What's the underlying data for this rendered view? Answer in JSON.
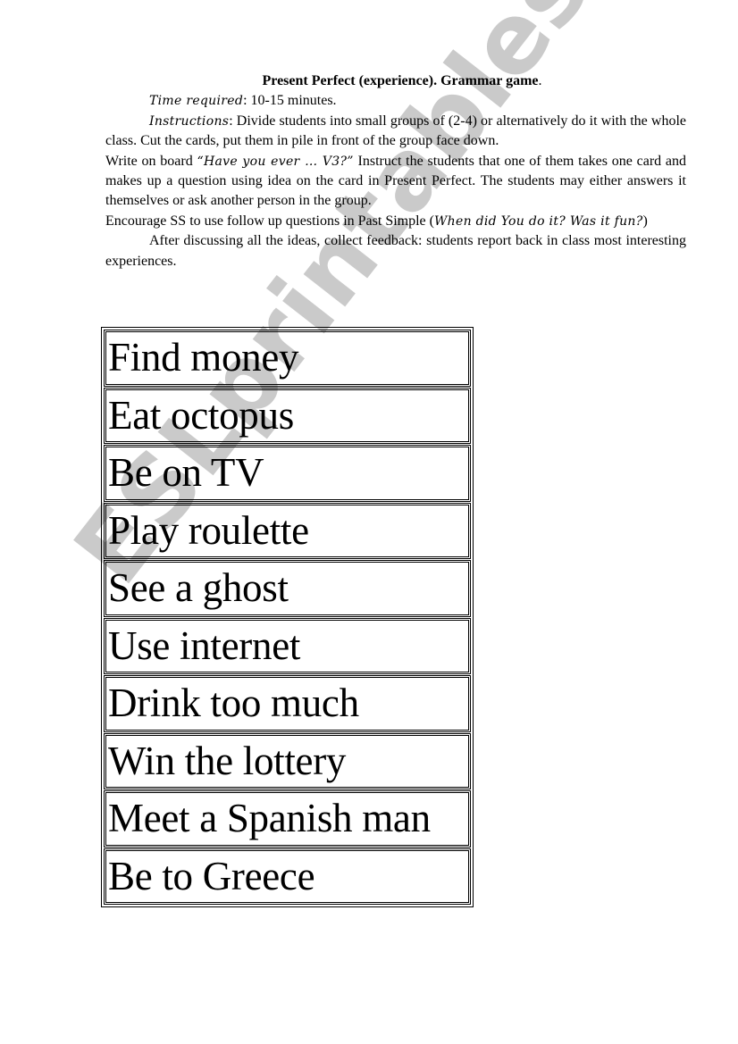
{
  "document": {
    "title": "Present Perfect (experience). Grammar game",
    "title_suffix": ".",
    "time_label": "Time required",
    "time_value": ": 10-15 minutes.",
    "instructions_label": "Instructions",
    "instructions_text": ": Divide students into small groups of (2-4) or alternatively do it with the whole class. Cut the cards, put them in pile in front of the group face down.",
    "board_prefix": "Write on board ",
    "board_quote": "“Have you ever … V3?”",
    "board_text": " Instruct the students that one of them takes one card and makes up a question using idea on the card in Present Perfect. The students may either answers it themselves or ask another person in the group.",
    "encourage_prefix": "Encourage SS to use follow up questions in Past Simple (",
    "encourage_example": "When did You do it? Was it fun?",
    "encourage_suffix": ")",
    "feedback_text": "After discussing all the ideas, collect feedback: students report back in class most interesting experiences."
  },
  "cards": [
    {
      "label": "Find money"
    },
    {
      "label": "Eat octopus"
    },
    {
      "label": "Be on TV"
    },
    {
      "label": "Play roulette"
    },
    {
      "label": "See a ghost"
    },
    {
      "label": "Use internet"
    },
    {
      "label": "Drink too much"
    },
    {
      "label": "Win the lottery"
    },
    {
      "label": "Meet a Spanish man"
    },
    {
      "label": "Be to Greece"
    }
  ],
  "watermark": {
    "text": "ESLprintables.com",
    "color": "#c8c8c8"
  }
}
